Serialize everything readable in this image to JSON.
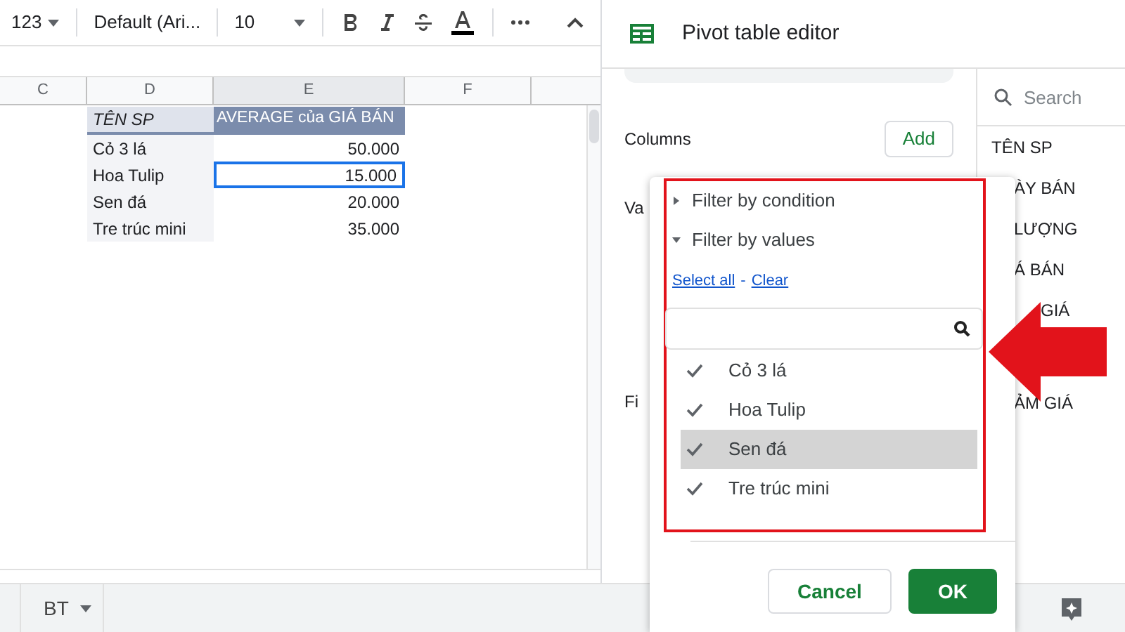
{
  "toolbar": {
    "number_format": "123",
    "font": "Default (Ari...",
    "font_size": "10"
  },
  "sheet": {
    "columns": [
      "C",
      "D",
      "E",
      "F"
    ],
    "header": {
      "name": "TÊN SP",
      "value": "AVERAGE của GIÁ BÁN"
    },
    "rows": [
      {
        "name": "Cỏ 3 lá",
        "value": "50.000",
        "selected": false
      },
      {
        "name": "Hoa Tulip",
        "value": "15.000",
        "selected": true
      },
      {
        "name": "Sen đá",
        "value": "20.000",
        "selected": false
      },
      {
        "name": "Tre trúc mini",
        "value": "35.000",
        "selected": false
      }
    ]
  },
  "sheet_tab": {
    "label": "BT"
  },
  "editor": {
    "title": "Pivot table editor",
    "sections": [
      {
        "label": "Columns",
        "button": "Add"
      },
      {
        "label": "Va"
      },
      {
        "label": "Fi"
      }
    ],
    "search": {
      "placeholder": "Search"
    },
    "fields": [
      {
        "label": "TÊN SP",
        "kind": "full"
      },
      {
        "label": "ÀY BÁN",
        "kind": "clipped"
      },
      {
        "label": "LƯỢNG",
        "kind": "clipped"
      },
      {
        "label": "Á BÁN",
        "kind": "clipped"
      },
      {
        "label": "GIÁ",
        "kind": "arrow"
      },
      {
        "label": "ẢM GIÁ",
        "kind": "clipped"
      }
    ]
  },
  "filter_popup": {
    "sections": [
      {
        "label": "Filter by condition",
        "expanded": false
      },
      {
        "label": "Filter by values",
        "expanded": true
      }
    ],
    "select_all": "Select all",
    "separator": "-",
    "clear": "Clear",
    "values": [
      {
        "label": "Cỏ 3 lá",
        "checked": true,
        "highlighted": false
      },
      {
        "label": "Hoa Tulip",
        "checked": true,
        "highlighted": false
      },
      {
        "label": "Sen đá",
        "checked": true,
        "highlighted": true
      },
      {
        "label": "Tre trúc mini",
        "checked": true,
        "highlighted": false
      }
    ],
    "buttons": [
      {
        "label": "Cancel",
        "kind": "secondary"
      },
      {
        "label": "OK",
        "kind": "primary"
      }
    ]
  }
}
